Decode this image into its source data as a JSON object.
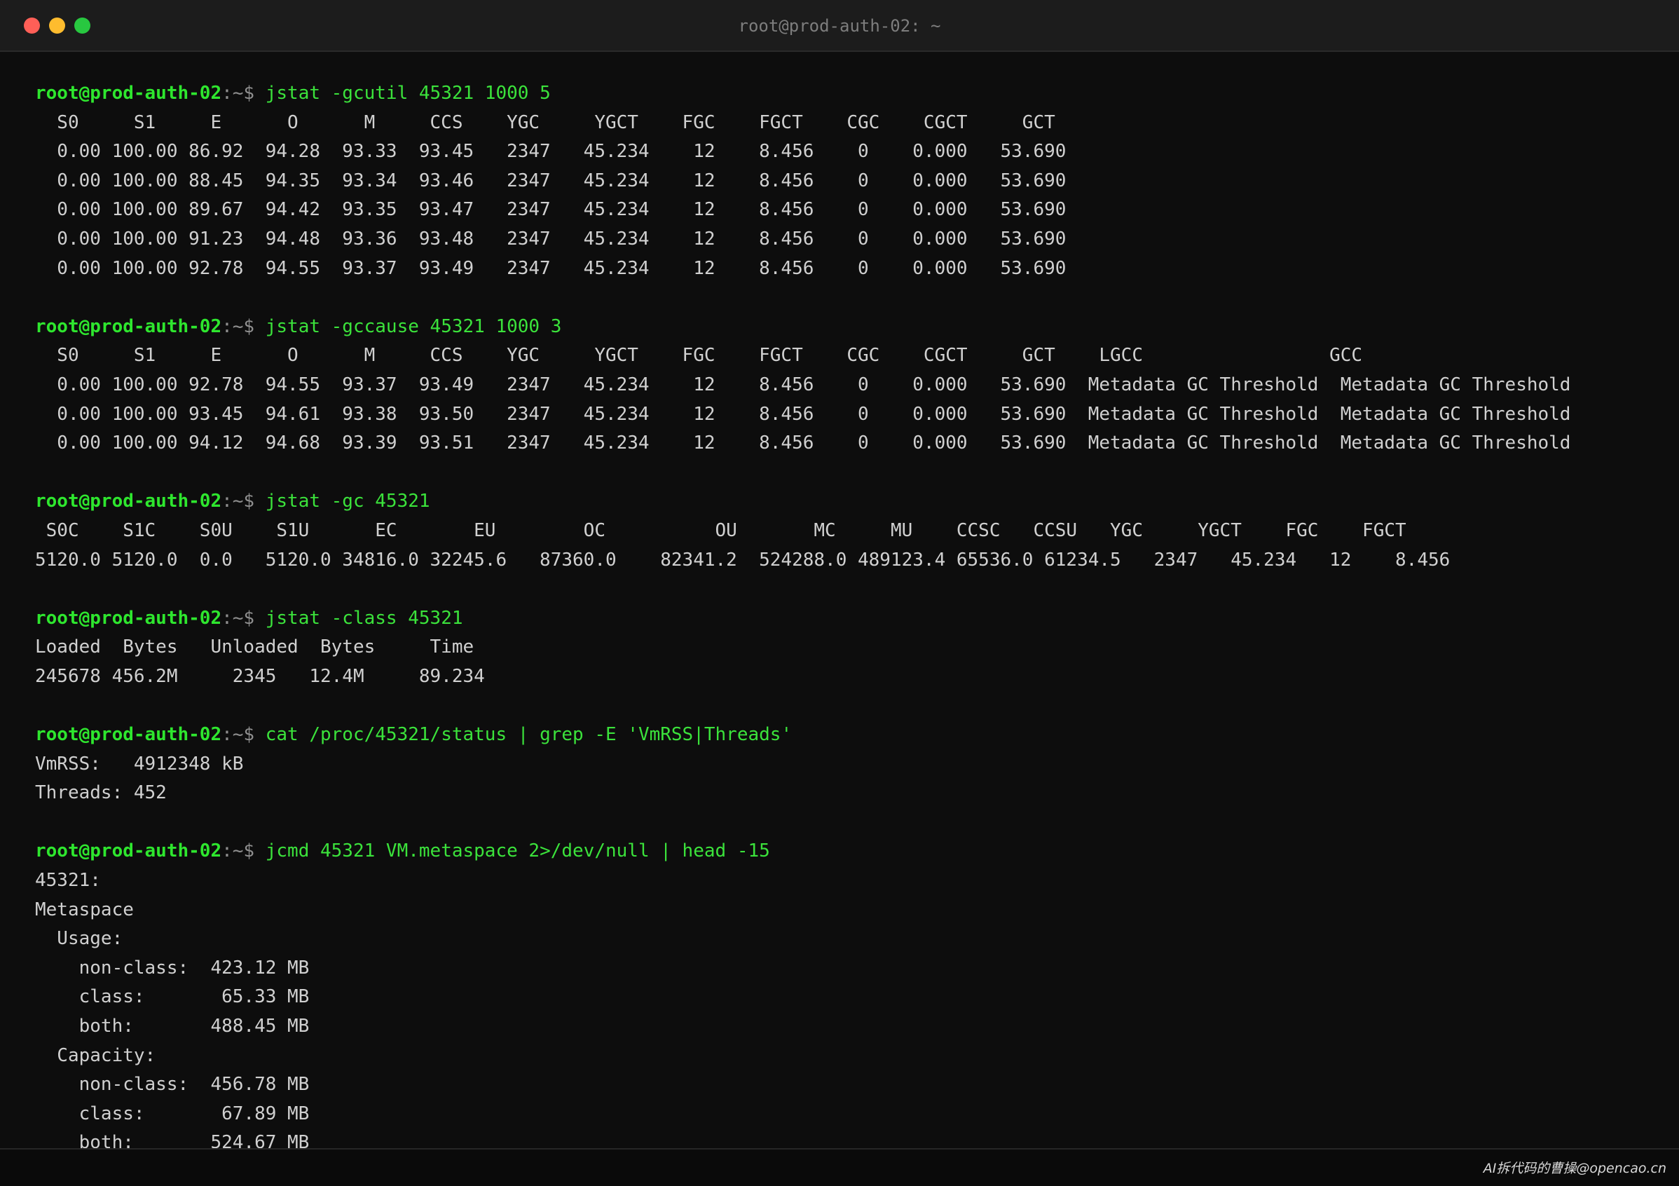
{
  "window": {
    "title": "root@prod-auth-02: ~"
  },
  "prompt": {
    "user_host": "root@prod-auth-02",
    "path_symbol": ":~$"
  },
  "blocks": [
    {
      "command": "jstat -gcutil 45321 1000 5",
      "output": [
        "  S0     S1     E      O      M     CCS    YGC     YGCT    FGC    FGCT    CGC    CGCT     GCT",
        "  0.00 100.00 86.92  94.28  93.33  93.45   2347   45.234    12    8.456    0    0.000   53.690",
        "  0.00 100.00 88.45  94.35  93.34  93.46   2347   45.234    12    8.456    0    0.000   53.690",
        "  0.00 100.00 89.67  94.42  93.35  93.47   2347   45.234    12    8.456    0    0.000   53.690",
        "  0.00 100.00 91.23  94.48  93.36  93.48   2347   45.234    12    8.456    0    0.000   53.690",
        "  0.00 100.00 92.78  94.55  93.37  93.49   2347   45.234    12    8.456    0    0.000   53.690"
      ]
    },
    {
      "command": "jstat -gccause 45321 1000 3",
      "output": [
        "  S0     S1     E      O      M     CCS    YGC     YGCT    FGC    FGCT    CGC    CGCT     GCT    LGCC                 GCC",
        "  0.00 100.00 92.78  94.55  93.37  93.49   2347   45.234    12    8.456    0    0.000   53.690  Metadata GC Threshold  Metadata GC Threshold",
        "  0.00 100.00 93.45  94.61  93.38  93.50   2347   45.234    12    8.456    0    0.000   53.690  Metadata GC Threshold  Metadata GC Threshold",
        "  0.00 100.00 94.12  94.68  93.39  93.51   2347   45.234    12    8.456    0    0.000   53.690  Metadata GC Threshold  Metadata GC Threshold"
      ]
    },
    {
      "command": "jstat -gc 45321",
      "output": [
        " S0C    S1C    S0U    S1U      EC       EU        OC          OU       MC     MU    CCSC   CCSU   YGC     YGCT    FGC    FGCT",
        "5120.0 5120.0  0.0   5120.0 34816.0 32245.6   87360.0    82341.2  524288.0 489123.4 65536.0 61234.5   2347   45.234   12    8.456"
      ]
    },
    {
      "command": "jstat -class 45321",
      "output": [
        "Loaded  Bytes   Unloaded  Bytes     Time",
        "245678 456.2M     2345   12.4M     89.234"
      ]
    },
    {
      "command": "cat /proc/45321/status | grep -E 'VmRSS|Threads'",
      "output": [
        "VmRSS:   4912348 kB",
        "Threads: 452"
      ]
    },
    {
      "command": "jcmd 45321 VM.metaspace 2>/dev/null | head -15",
      "output": [
        "45321:",
        "Metaspace",
        "  Usage:",
        "    non-class:  423.12 MB",
        "    class:       65.33 MB",
        "    both:       488.45 MB",
        "  Capacity:",
        "    non-class:  456.78 MB",
        "    class:       67.89 MB",
        "    both:       524.67 MB"
      ]
    }
  ],
  "footer": {
    "watermark": "AI拆代码的曹操@opencao.cn"
  }
}
